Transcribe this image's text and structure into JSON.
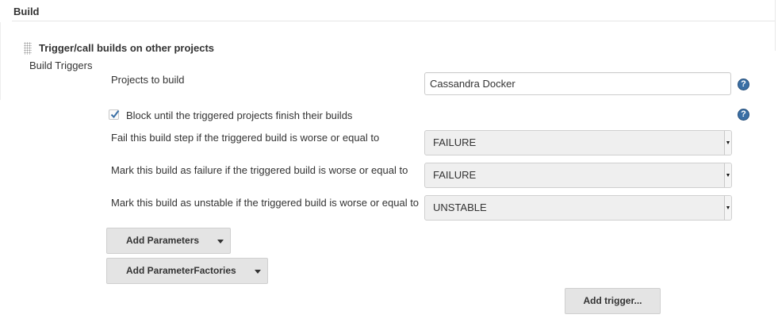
{
  "section": {
    "title": "Build"
  },
  "step": {
    "title": "Trigger/call builds on other projects",
    "subtitle": "Build Triggers"
  },
  "projects": {
    "label": "Projects to build",
    "value": "Cassandra Docker",
    "help": "?"
  },
  "block": {
    "label": "Block until the triggered projects finish their builds",
    "checked": true,
    "help": "?"
  },
  "fail_step": {
    "label": "Fail this build step if the triggered build is worse or equal to",
    "value": "FAILURE"
  },
  "mark_failure": {
    "label": "Mark this build as failure if the triggered build is worse or equal to",
    "value": "FAILURE"
  },
  "mark_unstable": {
    "label": "Mark this build as unstable if the triggered build is worse or equal to",
    "value": "UNSTABLE"
  },
  "buttons": {
    "add_parameters": "Add Parameters",
    "add_parameter_factories": "Add ParameterFactories",
    "add_trigger": "Add trigger..."
  },
  "colors": {
    "help_icon": "#3a6fa5",
    "button_bg": "#e4e4e4",
    "select_bg": "#efefef"
  },
  "icons": {
    "drag": "drag-handle-icon",
    "help": "help-icon",
    "check": "check-icon",
    "dropdown": "chevron-down-icon"
  }
}
